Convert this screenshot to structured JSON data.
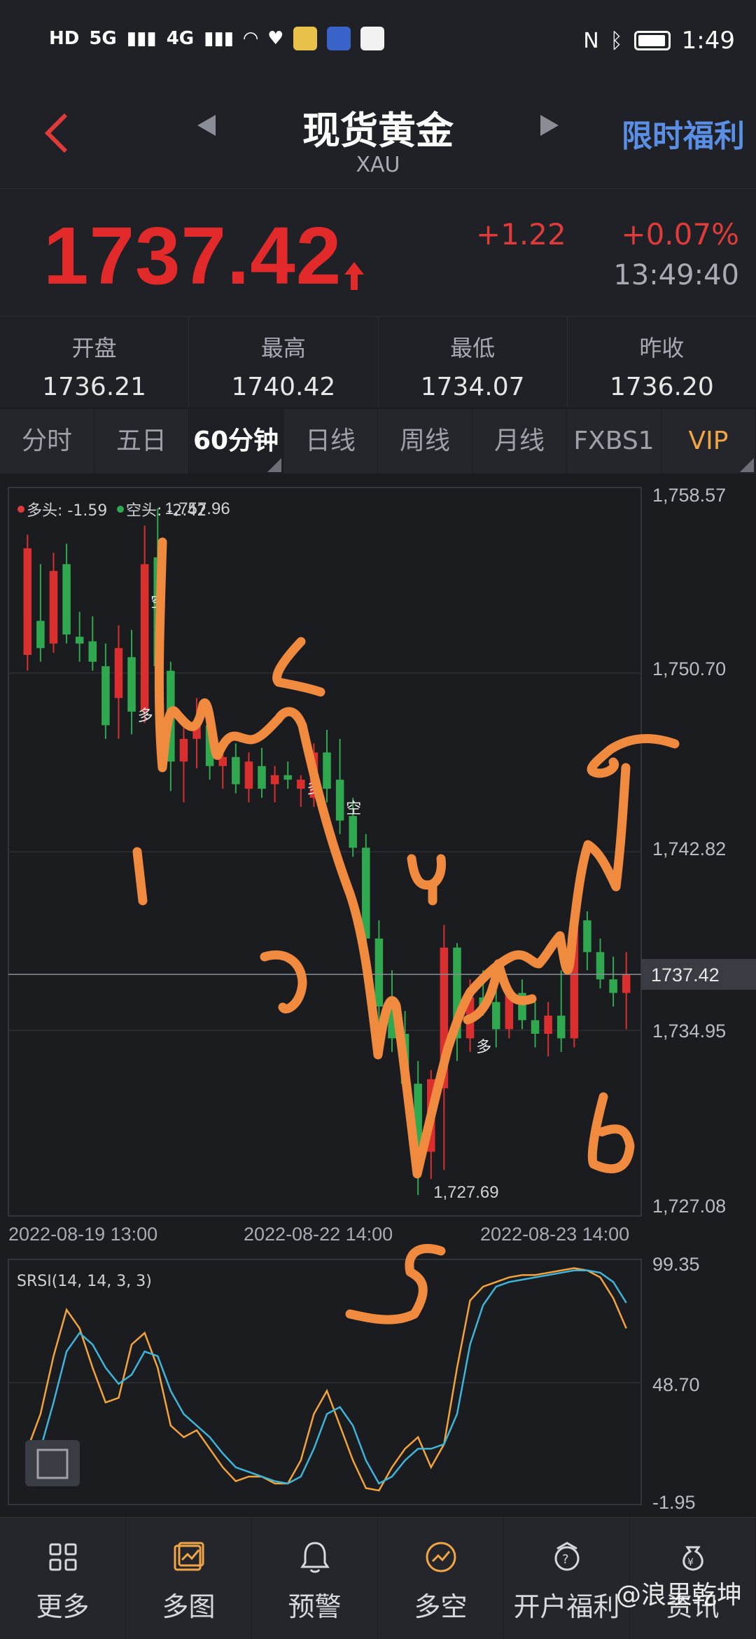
{
  "status_bar": {
    "network_left": "HD",
    "signal": "5G",
    "signal2": "4G",
    "time": "1:49"
  },
  "header": {
    "title": "现货黄金",
    "subtitle": "XAU",
    "promo_label": "限时福利",
    "back_icon": "chevron-left-icon",
    "prev_icon": "triangle-left-icon",
    "next_icon": "triangle-right-icon"
  },
  "quote": {
    "price": "1737.42",
    "change_abs": "+1.22",
    "change_pct": "+0.07%",
    "time": "13:49:40",
    "up_color": "#e32a2a"
  },
  "stats": [
    {
      "label": "开盘",
      "value": "1736.21"
    },
    {
      "label": "最高",
      "value": "1740.42"
    },
    {
      "label": "最低",
      "value": "1734.07"
    },
    {
      "label": "昨收",
      "value": "1736.20"
    }
  ],
  "tabs": [
    {
      "label": "分时"
    },
    {
      "label": "五日"
    },
    {
      "label": "60分钟"
    },
    {
      "label": "日线"
    },
    {
      "label": "周线"
    },
    {
      "label": "月线"
    },
    {
      "label": "FXBS1"
    },
    {
      "label": "VIP"
    }
  ],
  "chart_data": {
    "type": "candlestick",
    "legend": {
      "long_label": "多头: -1.59",
      "short_label": "空头: -2.42"
    },
    "y_ticks": [
      "1,758.57",
      "1,750.70",
      "1,742.82",
      "1,734.95",
      "1,727.08"
    ],
    "current_price_label": "1737.42",
    "max_label": "1,757.96",
    "min_label": "1,727.69",
    "x_ticks": [
      "2022-08-19 13:00",
      "2022-08-22 14:00",
      "2022-08-23 14:00"
    ],
    "ylim": [
      1727.08,
      1758.57
    ],
    "signals": [
      {
        "text": "空",
        "index": 10,
        "price": 1753.6
      },
      {
        "text": "多",
        "index": 9,
        "price": 1748.6
      },
      {
        "text": "多",
        "index": 22,
        "price": 1745.4
      },
      {
        "text": "空",
        "index": 25,
        "price": 1744.5
      },
      {
        "text": "多",
        "index": 35,
        "price": 1734.0
      }
    ],
    "candles": [
      {
        "o": 1751.5,
        "h": 1756.8,
        "l": 1750.8,
        "c": 1756.2
      },
      {
        "o": 1753.0,
        "h": 1755.5,
        "l": 1751.2,
        "c": 1751.8
      },
      {
        "o": 1752.0,
        "h": 1756.0,
        "l": 1751.6,
        "c": 1755.2
      },
      {
        "o": 1755.5,
        "h": 1756.4,
        "l": 1752.0,
        "c": 1752.4
      },
      {
        "o": 1752.3,
        "h": 1753.4,
        "l": 1751.2,
        "c": 1752.0
      },
      {
        "o": 1752.1,
        "h": 1753.2,
        "l": 1750.8,
        "c": 1751.2
      },
      {
        "o": 1751.0,
        "h": 1752.0,
        "l": 1747.8,
        "c": 1748.4
      },
      {
        "o": 1749.6,
        "h": 1752.8,
        "l": 1747.8,
        "c": 1751.8
      },
      {
        "o": 1751.4,
        "h": 1752.6,
        "l": 1748.0,
        "c": 1749.0
      },
      {
        "o": 1749.0,
        "h": 1757.2,
        "l": 1748.5,
        "c": 1755.5
      },
      {
        "o": 1755.8,
        "h": 1757.96,
        "l": 1749.0,
        "c": 1751.0
      },
      {
        "o": 1750.8,
        "h": 1751.2,
        "l": 1745.5,
        "c": 1746.8
      },
      {
        "o": 1746.8,
        "h": 1748.8,
        "l": 1745.0,
        "c": 1747.8
      },
      {
        "o": 1747.8,
        "h": 1749.6,
        "l": 1746.5,
        "c": 1748.4
      },
      {
        "o": 1748.4,
        "h": 1749.0,
        "l": 1746.0,
        "c": 1746.6
      },
      {
        "o": 1746.6,
        "h": 1747.6,
        "l": 1745.6,
        "c": 1747.0
      },
      {
        "o": 1747.0,
        "h": 1747.6,
        "l": 1745.4,
        "c": 1745.8
      },
      {
        "o": 1745.6,
        "h": 1747.2,
        "l": 1745.0,
        "c": 1746.8
      },
      {
        "o": 1746.6,
        "h": 1747.4,
        "l": 1745.2,
        "c": 1745.6
      },
      {
        "o": 1745.8,
        "h": 1746.6,
        "l": 1745.0,
        "c": 1746.2
      },
      {
        "o": 1746.2,
        "h": 1746.8,
        "l": 1745.6,
        "c": 1746.0
      },
      {
        "o": 1745.6,
        "h": 1746.2,
        "l": 1744.8,
        "c": 1746.0
      },
      {
        "o": 1745.2,
        "h": 1747.6,
        "l": 1744.8,
        "c": 1747.2
      },
      {
        "o": 1747.2,
        "h": 1748.2,
        "l": 1745.0,
        "c": 1745.6
      },
      {
        "o": 1746.0,
        "h": 1747.8,
        "l": 1743.6,
        "c": 1744.2
      },
      {
        "o": 1744.4,
        "h": 1745.2,
        "l": 1742.6,
        "c": 1743.0
      },
      {
        "o": 1743.0,
        "h": 1743.6,
        "l": 1738.6,
        "c": 1739.0
      },
      {
        "o": 1739.0,
        "h": 1739.8,
        "l": 1735.2,
        "c": 1736.0
      },
      {
        "o": 1736.0,
        "h": 1737.6,
        "l": 1734.0,
        "c": 1734.6
      },
      {
        "o": 1734.8,
        "h": 1735.8,
        "l": 1731.8,
        "c": 1732.6
      },
      {
        "o": 1732.6,
        "h": 1733.6,
        "l": 1727.69,
        "c": 1729.6
      },
      {
        "o": 1729.6,
        "h": 1733.2,
        "l": 1728.4,
        "c": 1732.8
      },
      {
        "o": 1732.4,
        "h": 1739.6,
        "l": 1728.8,
        "c": 1738.6
      },
      {
        "o": 1738.6,
        "h": 1738.8,
        "l": 1733.6,
        "c": 1734.6
      },
      {
        "o": 1734.6,
        "h": 1737.2,
        "l": 1734.0,
        "c": 1736.4
      },
      {
        "o": 1736.4,
        "h": 1737.6,
        "l": 1735.6,
        "c": 1736.0
      },
      {
        "o": 1736.2,
        "h": 1737.0,
        "l": 1734.2,
        "c": 1735.0
      },
      {
        "o": 1735.0,
        "h": 1737.0,
        "l": 1734.6,
        "c": 1736.6
      },
      {
        "o": 1736.6,
        "h": 1737.2,
        "l": 1735.0,
        "c": 1735.4
      },
      {
        "o": 1735.4,
        "h": 1736.2,
        "l": 1734.2,
        "c": 1734.8
      },
      {
        "o": 1734.8,
        "h": 1736.2,
        "l": 1733.8,
        "c": 1735.6
      },
      {
        "o": 1735.6,
        "h": 1737.6,
        "l": 1734.0,
        "c": 1734.6
      },
      {
        "o": 1734.6,
        "h": 1740.42,
        "l": 1734.2,
        "c": 1739.8
      },
      {
        "o": 1739.8,
        "h": 1740.2,
        "l": 1737.6,
        "c": 1738.4
      },
      {
        "o": 1738.4,
        "h": 1739.0,
        "l": 1736.8,
        "c": 1737.2
      },
      {
        "o": 1737.2,
        "h": 1738.2,
        "l": 1736.0,
        "c": 1736.6
      },
      {
        "o": 1736.6,
        "h": 1738.4,
        "l": 1735.0,
        "c": 1737.42
      }
    ]
  },
  "indicator": {
    "label": "SRSI(14, 14, 3, 3)",
    "y_ticks": [
      "99.35",
      "48.70",
      "-1.95"
    ],
    "ylim": [
      -1.95,
      99.35
    ],
    "k_color": "#f2a43a",
    "d_color": "#3fb4d9",
    "k": [
      20,
      35,
      60,
      80,
      72,
      55,
      40,
      42,
      65,
      70,
      55,
      30,
      25,
      28,
      20,
      12,
      6,
      8,
      8,
      5,
      5,
      15,
      35,
      45,
      30,
      15,
      3,
      2,
      12,
      20,
      25,
      12,
      22,
      55,
      84,
      90,
      92,
      94,
      95,
      95,
      96,
      97,
      98,
      97,
      94,
      85,
      72
    ],
    "d": [
      10,
      20,
      40,
      62,
      70,
      65,
      55,
      48,
      52,
      62,
      60,
      45,
      35,
      30,
      25,
      18,
      12,
      10,
      8,
      6,
      5,
      8,
      20,
      35,
      38,
      30,
      15,
      5,
      8,
      15,
      20,
      20,
      22,
      35,
      65,
      82,
      90,
      92,
      93,
      94,
      95,
      96,
      97,
      97,
      96,
      92,
      83
    ]
  },
  "bottom_nav": [
    {
      "label": "更多",
      "icon": "grid-icon"
    },
    {
      "label": "多图",
      "icon": "multi-chart-icon"
    },
    {
      "label": "预警",
      "icon": "bell-icon"
    },
    {
      "label": "多空",
      "icon": "long-short-icon"
    },
    {
      "label": "开户福利",
      "icon": "gift-icon"
    },
    {
      "label": "资讯",
      "icon": "money-bag-icon"
    }
  ],
  "watermark": "@浪里乾坤"
}
